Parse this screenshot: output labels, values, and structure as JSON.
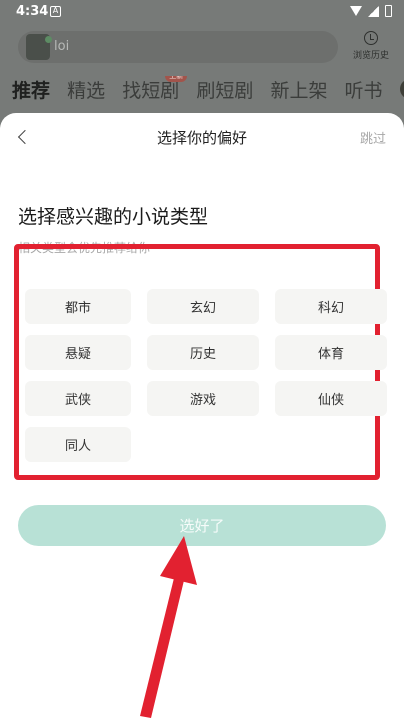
{
  "status_bar": {
    "time": "4:34",
    "notification_glyph": "A"
  },
  "background_app": {
    "search_placeholder": "loi",
    "history_label": "浏览历史",
    "tabs": [
      "推荐",
      "精选",
      "找短剧",
      "刷短剧",
      "新上架",
      "听书"
    ],
    "tab_badge": "上新"
  },
  "sheet": {
    "title": "选择你的偏好",
    "skip_label": "跳过",
    "heading": "选择感兴趣的小说类型",
    "subheading": "相关类型会优先推荐给你~",
    "genres": [
      "都市",
      "玄幻",
      "科幻",
      "悬疑",
      "历史",
      "体育",
      "武侠",
      "游戏",
      "仙侠",
      "同人"
    ],
    "confirm_label": "选好了"
  },
  "annotation": {
    "box_color": "#e22130",
    "arrow_color": "#e22130"
  },
  "colors": {
    "confirm_button": "#b8e1d6",
    "chip_background": "#f5f5f3"
  }
}
